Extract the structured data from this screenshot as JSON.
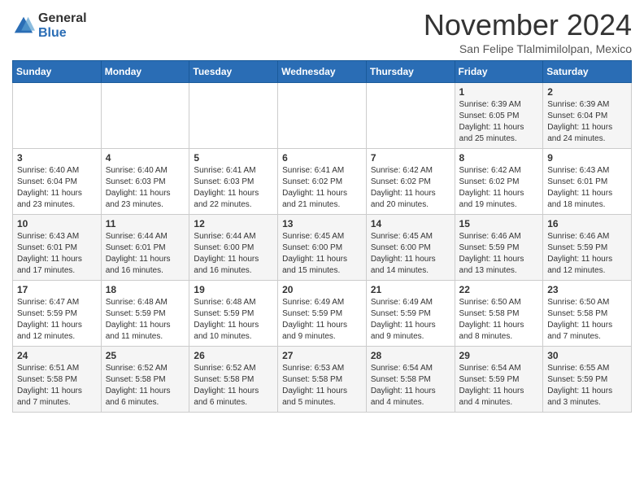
{
  "header": {
    "logo_general": "General",
    "logo_blue": "Blue",
    "month_title": "November 2024",
    "subtitle": "San Felipe Tlalmimilolpan, Mexico"
  },
  "days_of_week": [
    "Sunday",
    "Monday",
    "Tuesday",
    "Wednesday",
    "Thursday",
    "Friday",
    "Saturday"
  ],
  "weeks": [
    [
      {
        "day": "",
        "info": ""
      },
      {
        "day": "",
        "info": ""
      },
      {
        "day": "",
        "info": ""
      },
      {
        "day": "",
        "info": ""
      },
      {
        "day": "",
        "info": ""
      },
      {
        "day": "1",
        "info": "Sunrise: 6:39 AM\nSunset: 6:05 PM\nDaylight: 11 hours and 25 minutes."
      },
      {
        "day": "2",
        "info": "Sunrise: 6:39 AM\nSunset: 6:04 PM\nDaylight: 11 hours and 24 minutes."
      }
    ],
    [
      {
        "day": "3",
        "info": "Sunrise: 6:40 AM\nSunset: 6:04 PM\nDaylight: 11 hours and 23 minutes."
      },
      {
        "day": "4",
        "info": "Sunrise: 6:40 AM\nSunset: 6:03 PM\nDaylight: 11 hours and 23 minutes."
      },
      {
        "day": "5",
        "info": "Sunrise: 6:41 AM\nSunset: 6:03 PM\nDaylight: 11 hours and 22 minutes."
      },
      {
        "day": "6",
        "info": "Sunrise: 6:41 AM\nSunset: 6:02 PM\nDaylight: 11 hours and 21 minutes."
      },
      {
        "day": "7",
        "info": "Sunrise: 6:42 AM\nSunset: 6:02 PM\nDaylight: 11 hours and 20 minutes."
      },
      {
        "day": "8",
        "info": "Sunrise: 6:42 AM\nSunset: 6:02 PM\nDaylight: 11 hours and 19 minutes."
      },
      {
        "day": "9",
        "info": "Sunrise: 6:43 AM\nSunset: 6:01 PM\nDaylight: 11 hours and 18 minutes."
      }
    ],
    [
      {
        "day": "10",
        "info": "Sunrise: 6:43 AM\nSunset: 6:01 PM\nDaylight: 11 hours and 17 minutes."
      },
      {
        "day": "11",
        "info": "Sunrise: 6:44 AM\nSunset: 6:01 PM\nDaylight: 11 hours and 16 minutes."
      },
      {
        "day": "12",
        "info": "Sunrise: 6:44 AM\nSunset: 6:00 PM\nDaylight: 11 hours and 16 minutes."
      },
      {
        "day": "13",
        "info": "Sunrise: 6:45 AM\nSunset: 6:00 PM\nDaylight: 11 hours and 15 minutes."
      },
      {
        "day": "14",
        "info": "Sunrise: 6:45 AM\nSunset: 6:00 PM\nDaylight: 11 hours and 14 minutes."
      },
      {
        "day": "15",
        "info": "Sunrise: 6:46 AM\nSunset: 5:59 PM\nDaylight: 11 hours and 13 minutes."
      },
      {
        "day": "16",
        "info": "Sunrise: 6:46 AM\nSunset: 5:59 PM\nDaylight: 11 hours and 12 minutes."
      }
    ],
    [
      {
        "day": "17",
        "info": "Sunrise: 6:47 AM\nSunset: 5:59 PM\nDaylight: 11 hours and 12 minutes."
      },
      {
        "day": "18",
        "info": "Sunrise: 6:48 AM\nSunset: 5:59 PM\nDaylight: 11 hours and 11 minutes."
      },
      {
        "day": "19",
        "info": "Sunrise: 6:48 AM\nSunset: 5:59 PM\nDaylight: 11 hours and 10 minutes."
      },
      {
        "day": "20",
        "info": "Sunrise: 6:49 AM\nSunset: 5:59 PM\nDaylight: 11 hours and 9 minutes."
      },
      {
        "day": "21",
        "info": "Sunrise: 6:49 AM\nSunset: 5:59 PM\nDaylight: 11 hours and 9 minutes."
      },
      {
        "day": "22",
        "info": "Sunrise: 6:50 AM\nSunset: 5:58 PM\nDaylight: 11 hours and 8 minutes."
      },
      {
        "day": "23",
        "info": "Sunrise: 6:50 AM\nSunset: 5:58 PM\nDaylight: 11 hours and 7 minutes."
      }
    ],
    [
      {
        "day": "24",
        "info": "Sunrise: 6:51 AM\nSunset: 5:58 PM\nDaylight: 11 hours and 7 minutes."
      },
      {
        "day": "25",
        "info": "Sunrise: 6:52 AM\nSunset: 5:58 PM\nDaylight: 11 hours and 6 minutes."
      },
      {
        "day": "26",
        "info": "Sunrise: 6:52 AM\nSunset: 5:58 PM\nDaylight: 11 hours and 6 minutes."
      },
      {
        "day": "27",
        "info": "Sunrise: 6:53 AM\nSunset: 5:58 PM\nDaylight: 11 hours and 5 minutes."
      },
      {
        "day": "28",
        "info": "Sunrise: 6:54 AM\nSunset: 5:58 PM\nDaylight: 11 hours and 4 minutes."
      },
      {
        "day": "29",
        "info": "Sunrise: 6:54 AM\nSunset: 5:59 PM\nDaylight: 11 hours and 4 minutes."
      },
      {
        "day": "30",
        "info": "Sunrise: 6:55 AM\nSunset: 5:59 PM\nDaylight: 11 hours and 3 minutes."
      }
    ]
  ]
}
